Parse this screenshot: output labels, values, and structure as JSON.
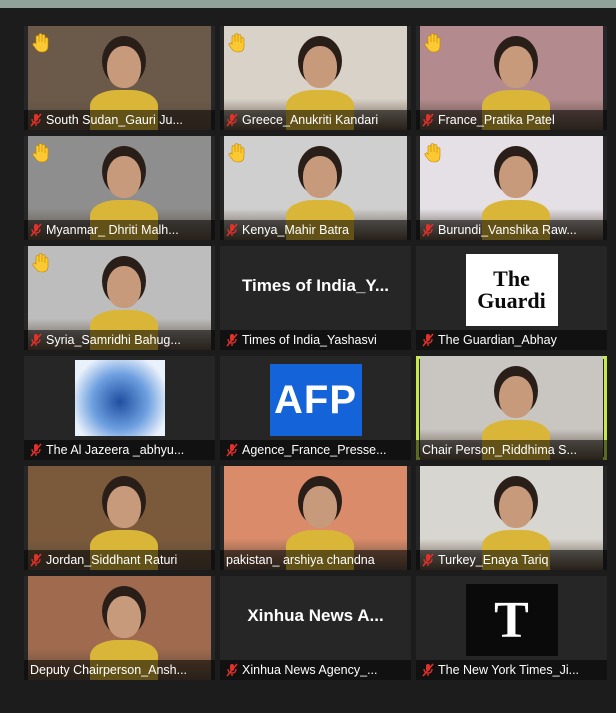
{
  "participants": [
    {
      "label": "South Sudan_Gauri Ju...",
      "hand": true,
      "bg": "#6b5a4a"
    },
    {
      "label": "Greece_Anukriti Kandari",
      "hand": true,
      "bg": "#d9d2c8"
    },
    {
      "label": "France_Pratika Patel",
      "hand": true,
      "bg": "#b38b8f"
    },
    {
      "label": "Myanmar_ Dhriti Malh...",
      "hand": true,
      "bg": "#8e8e8e"
    },
    {
      "label": "Kenya_Mahir Batra",
      "hand": true,
      "bg": "#cfcfcf"
    },
    {
      "label": "Burundi_Vanshika Raw...",
      "hand": true,
      "bg": "#e4e0e6"
    },
    {
      "label": "Syria_Samridhi Bahug...",
      "hand": true,
      "bg": "#bdbdbd"
    },
    {
      "label": "Times of India_Yashasvi",
      "hand": false,
      "title": "Times of India_Y...",
      "bg": "#262626"
    },
    {
      "label": "The Guardian_Abhay",
      "hand": false,
      "bg": "#262626",
      "logo": "The Guardi"
    },
    {
      "label": "The Al Jazeera _abhyu...",
      "hand": false,
      "bg": "#262626"
    },
    {
      "label": "Agence_France_Presse...",
      "hand": false,
      "bg": "#262626",
      "logo": "AFP"
    },
    {
      "label": "Chair Person_Riddhima S...",
      "hand": false,
      "bg": "#c9c6c2",
      "active": true,
      "mic_off": false
    },
    {
      "label": "Jordan_Siddhant Raturi",
      "hand": false,
      "bg": "#7a5a3b"
    },
    {
      "label": "pakistan_ arshiya chandna",
      "hand": false,
      "bg": "#d98b6a",
      "mic_off": false
    },
    {
      "label": "Turkey_Enaya Tariq",
      "hand": false,
      "bg": "#d8d6d0"
    },
    {
      "label": "Deputy Chairperson_Ansh...",
      "hand": false,
      "bg": "#a06a4e",
      "mic_off": false
    },
    {
      "label": "Xinhua News Agency_...",
      "hand": false,
      "title": "Xinhua News A...",
      "bg": "#262626"
    },
    {
      "label": "The New York Times_Ji...",
      "hand": false,
      "bg": "#262626",
      "logo": "T"
    }
  ],
  "colors": {
    "active_border": "#c7ea46",
    "mic_muted": "#e0312a",
    "hand": "#f2c94c"
  }
}
